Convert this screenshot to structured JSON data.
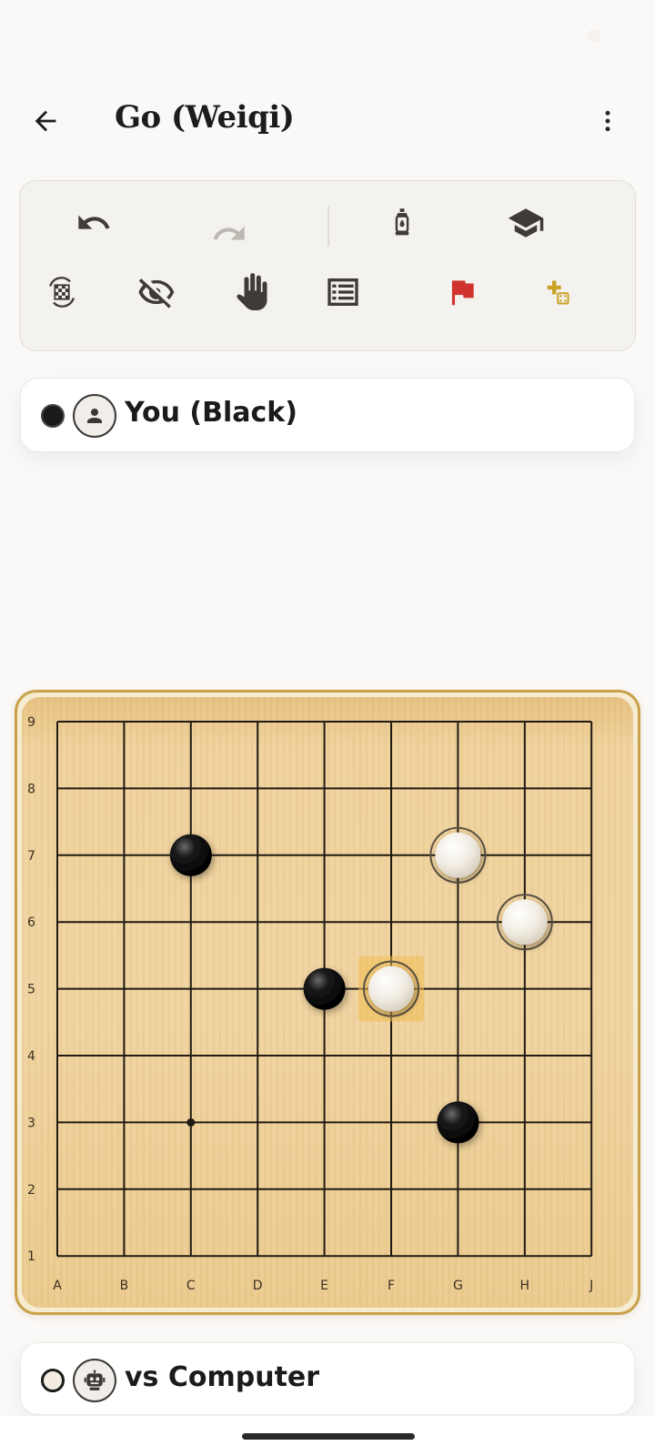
{
  "header": {
    "title": "Go (Weiqi)"
  },
  "toolbar": {
    "row1": [
      "undo-icon",
      "redo-icon",
      "lantern-hint-icon",
      "graduation-cap-icon"
    ],
    "row2": [
      "swap-board-icon",
      "eye-off-icon",
      "hand-pass-icon",
      "move-list-icon",
      "resign-flag-icon",
      "new-game-icon"
    ],
    "colors": {
      "icon": "#3f3b36",
      "disabled": "#bdb8b1",
      "flag": "#d0332e",
      "new_game": "#c9a227"
    }
  },
  "players": {
    "top": {
      "name": "You (Black)",
      "stone": "black",
      "avatar_icon": "person-icon"
    },
    "bottom": {
      "name": "vs Computer",
      "stone": "white",
      "avatar_icon": "robot-icon"
    }
  },
  "board": {
    "size": 9,
    "columns": [
      "A",
      "B",
      "C",
      "D",
      "E",
      "F",
      "G",
      "H",
      "J"
    ],
    "rows": [
      "1",
      "2",
      "3",
      "4",
      "5",
      "6",
      "7",
      "8",
      "9"
    ],
    "star_points": [
      [
        "C",
        3
      ]
    ],
    "last_move": [
      "F",
      5
    ],
    "stones": [
      {
        "col": "C",
        "row": 7,
        "color": "black"
      },
      {
        "col": "E",
        "row": 5,
        "color": "black"
      },
      {
        "col": "G",
        "row": 3,
        "color": "black"
      },
      {
        "col": "G",
        "row": 7,
        "color": "white"
      },
      {
        "col": "H",
        "row": 6,
        "color": "white"
      },
      {
        "col": "F",
        "row": 5,
        "color": "white"
      }
    ],
    "colors": {
      "frame": "#c9a14a",
      "grid": "#1f1a12",
      "label": "#3a3020"
    }
  }
}
